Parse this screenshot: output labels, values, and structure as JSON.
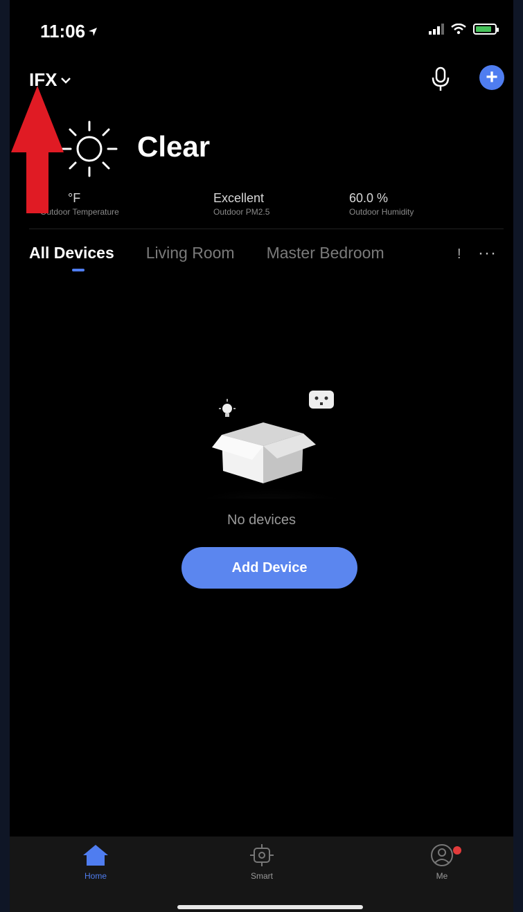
{
  "status_bar": {
    "time": "11:06"
  },
  "header": {
    "home_name": "IFX"
  },
  "weather": {
    "condition": "Clear",
    "stats": [
      {
        "value": "°F",
        "label": "Outdoor Temperature"
      },
      {
        "value": "Excellent",
        "label": "Outdoor PM2.5"
      },
      {
        "value": "60.0 %",
        "label": "Outdoor Humidity"
      }
    ]
  },
  "tabs": [
    "All Devices",
    "Living Room",
    "Master Bedroom"
  ],
  "tab_overflow": "!",
  "tab_more_icon": "···",
  "empty_state": {
    "text": "No devices",
    "button_label": "Add Device"
  },
  "bottom_nav": [
    {
      "label": "Home",
      "icon": "home-icon",
      "active": true
    },
    {
      "label": "Smart",
      "icon": "smart-icon",
      "active": false
    },
    {
      "label": "Me",
      "icon": "me-icon",
      "active": false
    }
  ],
  "colors": {
    "accent": "#4f7df0",
    "background": "#000000",
    "annotation_arrow": "#e01b24"
  }
}
